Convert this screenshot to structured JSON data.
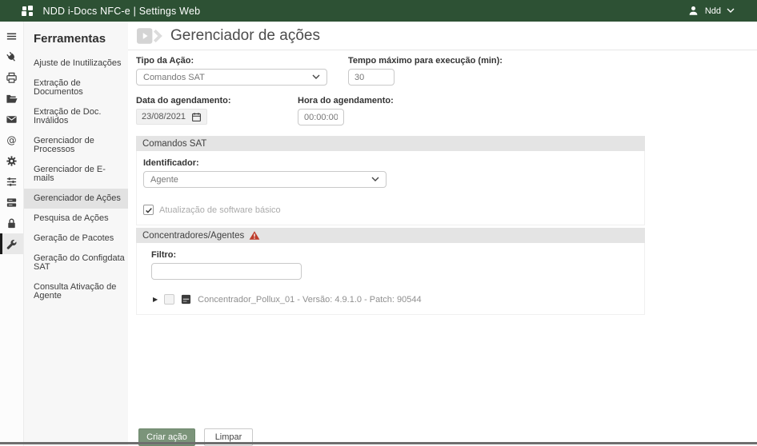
{
  "topbar": {
    "title": "NDD i-Docs NFC-e | Settings Web",
    "user_name": "Ndd"
  },
  "rail": {
    "icons": [
      "menu",
      "plug",
      "printer",
      "folder",
      "mail",
      "at-sign",
      "gear",
      "sliders",
      "server",
      "lock",
      "wrench"
    ],
    "selected": "wrench"
  },
  "sidebar": {
    "title": "Ferramentas",
    "items": [
      "Ajuste de Inutilizações",
      "Extração de Documentos",
      "Extração de Doc. Inválidos",
      "Gerenciador de Processos",
      "Gerenciador de E-mails",
      "Gerenciador de Ações",
      "Pesquisa de Ações",
      "Geração de Pacotes",
      "Geração do Configdata SAT",
      "Consulta Ativação de Agente"
    ],
    "selected": "Gerenciador de Ações"
  },
  "page": {
    "title": "Gerenciador de ações"
  },
  "form": {
    "tipo_acao": {
      "label": "Tipo da Ação:",
      "value": "Comandos SAT"
    },
    "tempo_maximo": {
      "label": "Tempo máximo para execução (min):",
      "value": "30"
    },
    "data_agendamento": {
      "label": "Data do agendamento:",
      "value": "23/08/2021"
    },
    "hora_agendamento": {
      "label": "Hora do agendamento:",
      "value": "00:00:00"
    }
  },
  "comandos_sat": {
    "header": "Comandos SAT",
    "identificador": {
      "label": "Identificador:",
      "value": "Agente"
    },
    "atualizacao_checkbox": {
      "label": "Atualização de software básico",
      "checked": true
    }
  },
  "concentradores": {
    "header": "Concentradores/Agentes",
    "filtro": {
      "label": "Filtro:",
      "value": ""
    },
    "tree": [
      {
        "label": "Concentrador_Pollux_01 - Versão: 4.9.1.0 - Patch: 90544",
        "expanded": false,
        "checked": false
      }
    ]
  },
  "buttons": {
    "create": "Criar ação",
    "clear": "Limpar"
  },
  "icons": {
    "tree_expand": "▶"
  },
  "colors": {
    "topbar_green": "#2d5134",
    "button_green": "#7b947a",
    "warning_red": "#bd3b2a",
    "selected_item_bg": "#e2e2e2"
  }
}
